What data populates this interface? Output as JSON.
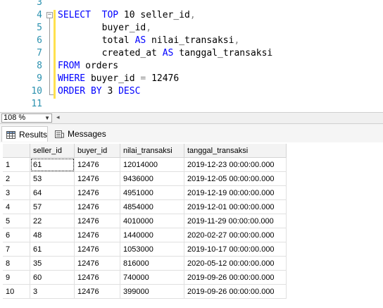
{
  "editor": {
    "line_numbers": [
      "3",
      "4",
      "5",
      "6",
      "7",
      "8",
      "9",
      "10",
      "11"
    ],
    "fold_glyph": "−",
    "lines": [
      [
        {
          "t": "",
          "c": ""
        }
      ],
      [
        {
          "t": "SELECT  ",
          "c": "kw"
        },
        {
          "t": "TOP",
          "c": "kw"
        },
        {
          "t": " 10 seller_id",
          "c": ""
        },
        {
          "t": ",",
          "c": "op"
        }
      ],
      [
        {
          "t": "        buyer_id",
          "c": ""
        },
        {
          "t": ",",
          "c": "op"
        }
      ],
      [
        {
          "t": "        total ",
          "c": ""
        },
        {
          "t": "AS",
          "c": "kw"
        },
        {
          "t": " nilai_transaksi",
          "c": ""
        },
        {
          "t": ",",
          "c": "op"
        }
      ],
      [
        {
          "t": "        created_at ",
          "c": ""
        },
        {
          "t": "AS",
          "c": "kw"
        },
        {
          "t": " tanggal_transaksi",
          "c": ""
        }
      ],
      [
        {
          "t": "FROM",
          "c": "kw"
        },
        {
          "t": " orders",
          "c": ""
        }
      ],
      [
        {
          "t": "WHERE",
          "c": "kw"
        },
        {
          "t": " buyer_id ",
          "c": ""
        },
        {
          "t": "=",
          "c": "op"
        },
        {
          "t": " 12476",
          "c": ""
        }
      ],
      [
        {
          "t": "ORDER BY",
          "c": "kw"
        },
        {
          "t": " 3 ",
          "c": ""
        },
        {
          "t": "DESC",
          "c": "kw"
        }
      ],
      [
        {
          "t": "",
          "c": ""
        }
      ]
    ]
  },
  "status": {
    "zoom": "108 %"
  },
  "tabs": [
    {
      "label": "Results",
      "icon": "grid-icon",
      "active": true
    },
    {
      "label": "Messages",
      "icon": "messages-icon",
      "active": false
    }
  ],
  "grid": {
    "columns": [
      "",
      "seller_id",
      "buyer_id",
      "nilai_transaksi",
      "tanggal_transaksi"
    ],
    "rows": [
      [
        "1",
        "61",
        "12476",
        "12014000",
        "2019-12-23 00:00:00.000"
      ],
      [
        "2",
        "53",
        "12476",
        "9436000",
        "2019-12-05 00:00:00.000"
      ],
      [
        "3",
        "64",
        "12476",
        "4951000",
        "2019-12-19 00:00:00.000"
      ],
      [
        "4",
        "57",
        "12476",
        "4854000",
        "2019-12-01 00:00:00.000"
      ],
      [
        "5",
        "22",
        "12476",
        "4010000",
        "2019-11-29 00:00:00.000"
      ],
      [
        "6",
        "48",
        "12476",
        "1440000",
        "2020-02-27 00:00:00.000"
      ],
      [
        "7",
        "61",
        "12476",
        "1053000",
        "2019-10-17 00:00:00.000"
      ],
      [
        "8",
        "35",
        "12476",
        "816000",
        "2020-05-12 00:00:00.000"
      ],
      [
        "9",
        "60",
        "12476",
        "740000",
        "2019-09-26 00:00:00.000"
      ],
      [
        "10",
        "3",
        "12476",
        "399000",
        "2019-09-26 00:00:00.000"
      ]
    ]
  }
}
